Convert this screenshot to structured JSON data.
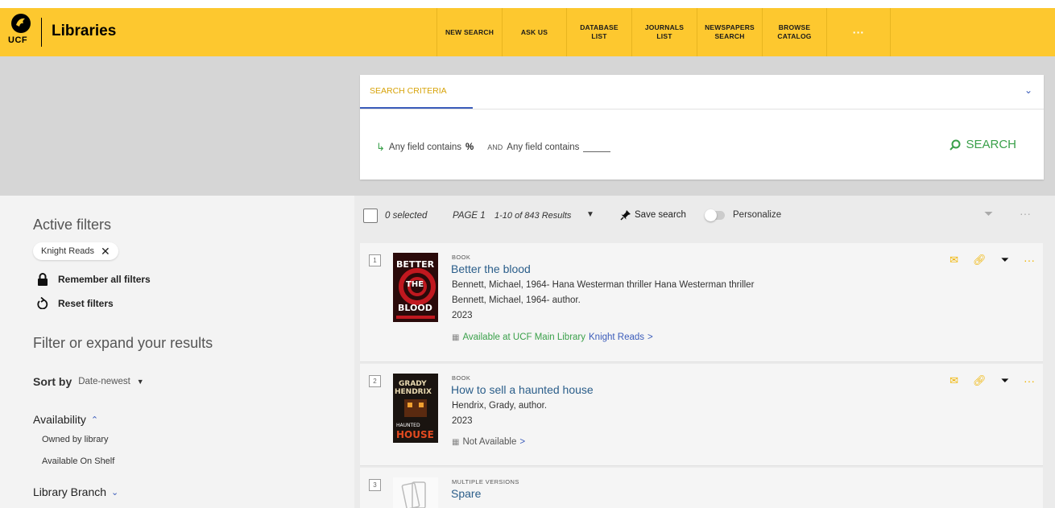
{
  "header": {
    "logo_text": "UCF",
    "brand": "Libraries",
    "nav": [
      {
        "label": "NEW SEARCH"
      },
      {
        "label": "ASK US"
      },
      {
        "label": "DATABASE\nLIST"
      },
      {
        "label": "JOURNALS\nLIST"
      },
      {
        "label": "NEWSPAPERS\nSEARCH"
      },
      {
        "label": "BROWSE\nCATALOG"
      },
      {
        "label": "···"
      }
    ]
  },
  "search": {
    "tab_label": "SEARCH CRITERIA",
    "query_field1": "Any field contains",
    "query_value1": "%",
    "query_and": "AND",
    "query_field2": "Any field contains",
    "button_label": "SEARCH"
  },
  "filters": {
    "active_title": "Active filters",
    "chip_label": "Knight Reads",
    "remember_label": "Remember all filters",
    "reset_label": "Reset filters",
    "filter_title": "Filter or expand your results",
    "sort_label": "Sort by",
    "sort_value": "Date-newest",
    "availability_label": "Availability",
    "availability_options": [
      "Owned by library",
      "Available On Shelf"
    ],
    "branch_label": "Library Branch"
  },
  "toolbar": {
    "selected": "0 selected",
    "page": "PAGE 1",
    "range": "1-10 of 843 Results",
    "save_search": "Save search",
    "personalize": "Personalize"
  },
  "records": [
    {
      "num": "1",
      "type": "BOOK",
      "title": "Better the blood",
      "line1": "Bennett, Michael, 1964- Hana Westerman thriller Hana Westerman thriller",
      "line2": "Bennett, Michael, 1964- author.",
      "year": "2023",
      "avail_status": "Available at UCF Main Library",
      "avail_location": "Knight Reads",
      "avail_arrow": ">"
    },
    {
      "num": "2",
      "type": "BOOK",
      "title": "How to sell a haunted house",
      "line1": "Hendrix, Grady, author.",
      "year": "2023",
      "avail_status": "Not Available",
      "avail_arrow": ">"
    },
    {
      "num": "3",
      "type": "MULTIPLE VERSIONS",
      "title": "Spare"
    }
  ],
  "colors": {
    "brand_gold": "#fdc82f",
    "link_blue": "#2b5e8a",
    "available_green": "#3aa04a",
    "accent_blue": "#3b5cba"
  }
}
